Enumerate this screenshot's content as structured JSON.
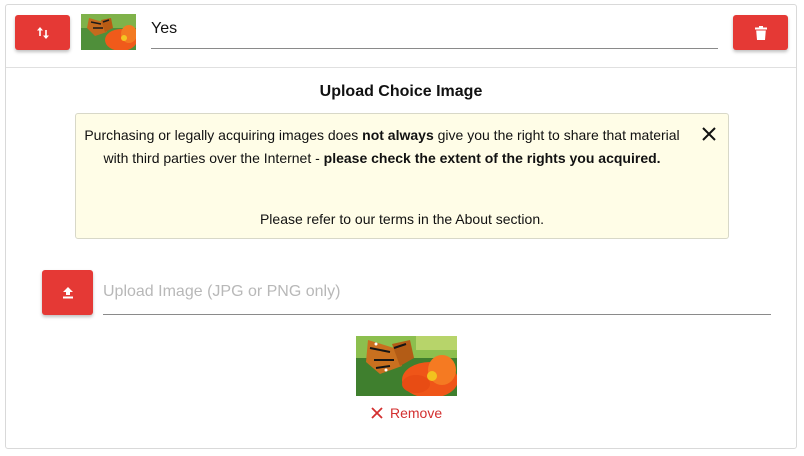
{
  "choice": {
    "text": "Yes"
  },
  "upload_section": {
    "title": "Upload Choice Image",
    "notice": {
      "part1": "Purchasing or legally acquiring images does ",
      "part2": "not always",
      "part3": " give you the right to share that material with third parties over the Internet - ",
      "part4": "please check the extent of the rights you acquired.",
      "footer": "Please refer to our terms in the About section."
    },
    "upload_placeholder": "Upload Image (JPG or PNG only)",
    "remove_label": "Remove"
  },
  "icons": {
    "sort": "sort-arrows-icon",
    "delete": "trash-icon",
    "upload": "upload-icon",
    "close": "close-icon",
    "remove": "x-icon"
  },
  "colors": {
    "accent": "#e53935",
    "notice_bg": "#fffde7",
    "remove_text": "#d32f2f"
  }
}
